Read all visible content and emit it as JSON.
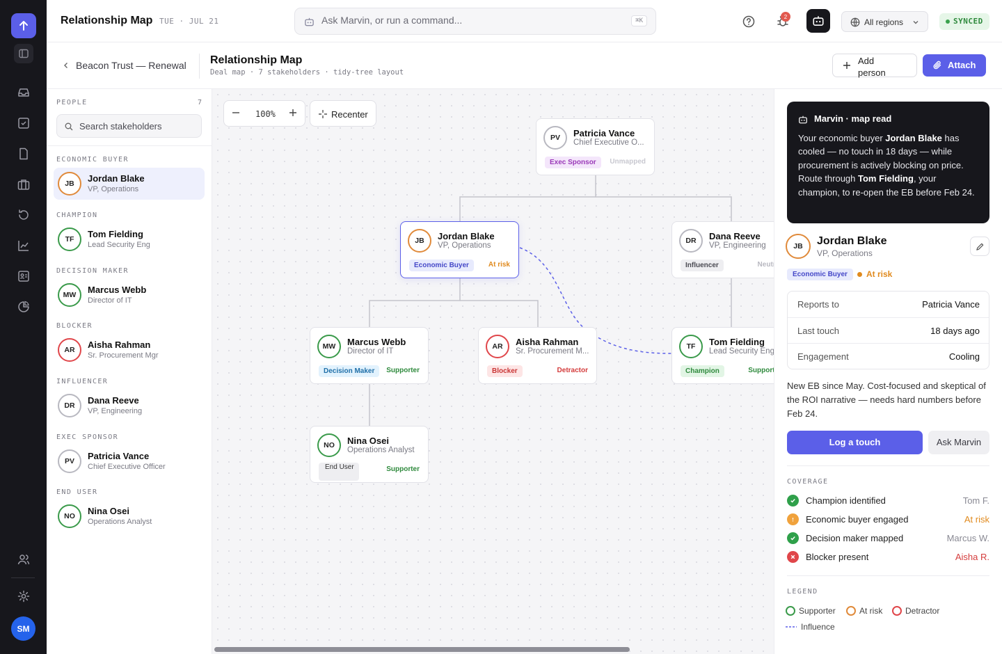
{
  "app": {
    "title": "Relationship Map",
    "date": "TUE · JUL 21"
  },
  "command": {
    "placeholder": "Ask Marvin, or run a command...",
    "shortcut": "⌘K"
  },
  "topbar": {
    "notification_count": "2",
    "region": "All regions",
    "sync_status": "SYNCED"
  },
  "user": {
    "initials": "SM"
  },
  "subheader": {
    "breadcrumb": "Beacon Trust — Renewal",
    "title": "Relationship Map",
    "meta": "Deal map · 7 stakeholders · tidy-tree layout",
    "add_label": "Add person",
    "attach_label": "Attach"
  },
  "people": {
    "heading": "PEOPLE",
    "count": "7",
    "search_placeholder": "Search stakeholders",
    "groups": [
      {
        "label": "ECONOMIC BUYER",
        "initials": "JB",
        "name": "Jordan Blake",
        "role": "VP, Operations",
        "stance": "risk"
      },
      {
        "label": "CHAMPION",
        "initials": "TF",
        "name": "Tom Fielding",
        "role": "Lead Security Eng",
        "stance": "sup"
      },
      {
        "label": "DECISION MAKER",
        "initials": "MW",
        "name": "Marcus Webb",
        "role": "Director of IT",
        "stance": "sup"
      },
      {
        "label": "BLOCKER",
        "initials": "AR",
        "name": "Aisha Rahman",
        "role": "Sr. Procurement Mgr",
        "stance": "det"
      },
      {
        "label": "INFLUENCER",
        "initials": "DR",
        "name": "Dana Reeve",
        "role": "VP, Engineering",
        "stance": "neu"
      },
      {
        "label": "EXEC SPONSOR",
        "initials": "PV",
        "name": "Patricia Vance",
        "role": "Chief Executive Officer",
        "stance": "neu"
      },
      {
        "label": "END USER",
        "initials": "NO",
        "name": "Nina Osei",
        "role": "Operations Analyst",
        "stance": "sup"
      }
    ]
  },
  "canvas": {
    "zoom": "100%",
    "recenter_label": "Recenter",
    "cards": [
      {
        "initials": "PV",
        "name": "Patricia Vance",
        "role": "Chief Executive O...",
        "tag": "Exec Sponsor",
        "stance": "Unmapped"
      },
      {
        "initials": "JB",
        "name": "Jordan Blake",
        "role": "VP, Operations",
        "tag": "Economic Buyer",
        "stance": "At risk"
      },
      {
        "initials": "DR",
        "name": "Dana Reeve",
        "role": "VP, Engineering",
        "tag": "Influencer",
        "stance": "Neutral"
      },
      {
        "initials": "MW",
        "name": "Marcus Webb",
        "role": "Director of IT",
        "tag": "Decision Maker",
        "stance": "Supporter"
      },
      {
        "initials": "AR",
        "name": "Aisha Rahman",
        "role": "Sr. Procurement M...",
        "tag": "Blocker",
        "stance": "Detractor"
      },
      {
        "initials": "TF",
        "name": "Tom Fielding",
        "role": "Lead Security Eng",
        "tag": "Champion",
        "stance": "Supporter"
      },
      {
        "initials": "NO",
        "name": "Nina Osei",
        "role": "Operations Analyst",
        "tag": "End User",
        "stance": "Supporter"
      }
    ]
  },
  "insight": {
    "title": "Marvin · map read",
    "p1": "Your economic buyer ",
    "b1": "Jordan Blake",
    "p2": " has cooled — no touch in 18 days — while procurement is actively blocking on price. Route through ",
    "b2": "Tom Fielding",
    "p3": ", your champion, to re-open the EB before Feb 24."
  },
  "detail": {
    "initials": "JB",
    "name": "Jordan Blake",
    "role": "VP, Operations",
    "tag": "Economic Buyer",
    "stance": "At risk",
    "facts": [
      {
        "key": "Reports to",
        "value": "Patricia Vance"
      },
      {
        "key": "Last touch",
        "value": "18 days ago"
      },
      {
        "key": "Engagement",
        "value": "Cooling"
      }
    ],
    "note": "New EB since May. Cost-focused and skeptical of the ROI narrative — needs hard numbers before Feb 24.",
    "log_label": "Log a touch",
    "ask_label": "Ask Marvin"
  },
  "coverage": {
    "heading": "COVERAGE",
    "items": [
      {
        "label": "Champion identified",
        "value": "Tom F.",
        "status": "ok"
      },
      {
        "label": "Economic buyer engaged",
        "value": "At risk",
        "status": "warn"
      },
      {
        "label": "Decision maker mapped",
        "value": "Marcus W.",
        "status": "ok"
      },
      {
        "label": "Blocker present",
        "value": "Aisha R.",
        "status": "bad"
      }
    ]
  },
  "legend": {
    "heading": "LEGEND",
    "supporter": "Supporter",
    "at_risk": "At risk",
    "detractor": "Detractor",
    "influence": "Influence"
  },
  "colors": {
    "accent": "#5b5fe8",
    "supporter": "#3a9a4a",
    "at_risk": "#e08a3a",
    "detractor": "#e0464a"
  }
}
